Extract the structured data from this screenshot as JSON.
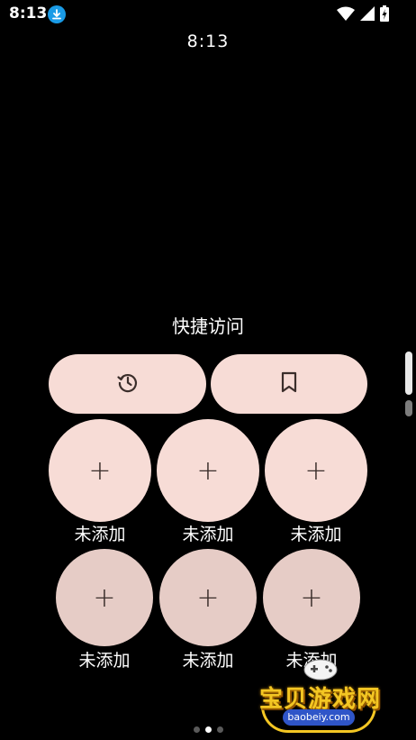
{
  "status_bar": {
    "time": "8:13",
    "icons": [
      "download-icon",
      "wifi-icon",
      "cellular-signal-icon",
      "battery-charging-icon"
    ]
  },
  "clock": "8:13",
  "quick_access": {
    "title": "快捷访问",
    "top_actions": [
      {
        "icon": "history-icon"
      },
      {
        "icon": "bookmark-icon"
      }
    ],
    "slot_label": "未添加",
    "slots": [
      "未添加",
      "未添加",
      "未添加",
      "未添加",
      "未添加",
      "未添加"
    ]
  },
  "page_indicator": {
    "count": 3,
    "active": 2
  },
  "watermark": {
    "text": "宝贝游戏网",
    "url": "baobeiy.com"
  },
  "colors": {
    "background": "#000000",
    "pill": "#f7dcd6",
    "circle_row1": "#f7dcd6",
    "circle_row2": "#e6ccc6",
    "download_badge": "#1a9be6"
  }
}
